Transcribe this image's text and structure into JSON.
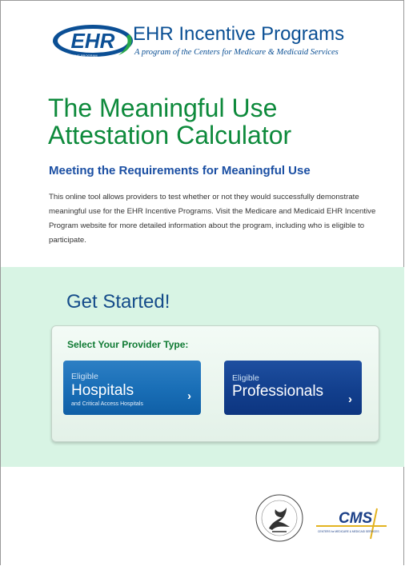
{
  "header": {
    "logo_text": "EHR",
    "logo_small": "INCENTIVE PROGRAM",
    "title": "EHR Incentive Programs",
    "subtitle": "A program of the Centers for Medicare & Medicaid Services"
  },
  "main": {
    "title": "The Meaningful Use Attestation Calculator",
    "subtitle": "Meeting the Requirements for Meaningful Use",
    "intro": "This online tool allows providers to test whether or not they would successfully demonstrate meaningful use for the EHR Incentive Programs. Visit the Medicare and Medicaid EHR Incentive Program website for more detailed information about the program, including who is eligible to participate."
  },
  "get_started": {
    "heading": "Get Started!",
    "panel_label": "Select Your Provider Type:",
    "hospitals": {
      "small": "Eligible",
      "big": "Hospitals",
      "tiny": "and Critical Access Hospitals",
      "chevron": "›"
    },
    "professionals": {
      "small": "Eligible",
      "big": "Professionals",
      "chevron": "›"
    }
  },
  "footer": {
    "cms_text": "CMS",
    "cms_small": "CENTERS for MEDICARE & MEDICAID SERVICES"
  },
  "colors": {
    "title_green": "#0e8a3c",
    "subtitle_blue": "#1b4fa3",
    "band_green": "#d8f4e4",
    "hospital_blue": "#1a6fb7",
    "professional_navy": "#123f8d"
  },
  "icons": [
    "ehr-logo-icon",
    "hhs-seal-icon",
    "cms-logo-icon",
    "chevron-right-icon"
  ]
}
